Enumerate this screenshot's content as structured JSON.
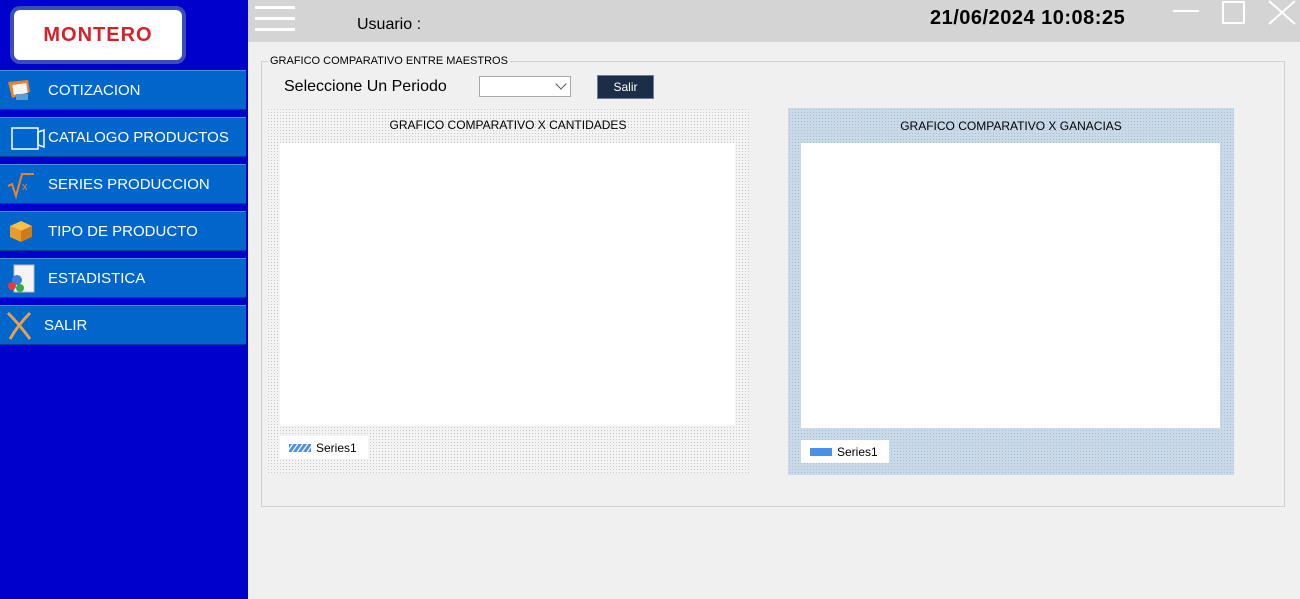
{
  "brand": {
    "logo_text": "MONTERO"
  },
  "sidebar": {
    "items": [
      {
        "label": "COTIZACION",
        "icon": "quote-icon"
      },
      {
        "label": "CATALOGO PRODUCTOS",
        "icon": "folder-icon"
      },
      {
        "label": "SERIES PRODUCCION",
        "icon": "sqrt-icon"
      },
      {
        "label": "TIPO DE PRODUCTO",
        "icon": "box-icon"
      },
      {
        "label": "ESTADISTICA",
        "icon": "stats-icon"
      },
      {
        "label": "SALIR",
        "icon": "exit-icon"
      }
    ]
  },
  "topbar": {
    "user_label": "Usuario :",
    "datetime": "21/06/2024 10:08:25"
  },
  "main": {
    "group_title": "GRAFICO COMPARATIVO ENTRE MAESTROS",
    "period_label": "Seleccione Un Periodo",
    "period_value": "",
    "exit_button": "Salir"
  },
  "chart_data": [
    {
      "type": "bar",
      "title": "GRAFICO COMPARATIVO X CANTIDADES",
      "series": [
        {
          "name": "Series1",
          "values": []
        }
      ],
      "categories": []
    },
    {
      "type": "bar",
      "title": "GRAFICO COMPARATIVO X GANACIAS",
      "series": [
        {
          "name": "Series1",
          "values": []
        }
      ],
      "categories": []
    }
  ],
  "colors": {
    "sidebar_bg": "#0000cc",
    "nav_item_bg": "#0066cc",
    "logo_red": "#d8202a",
    "series_blue": "#4a8fe8"
  }
}
